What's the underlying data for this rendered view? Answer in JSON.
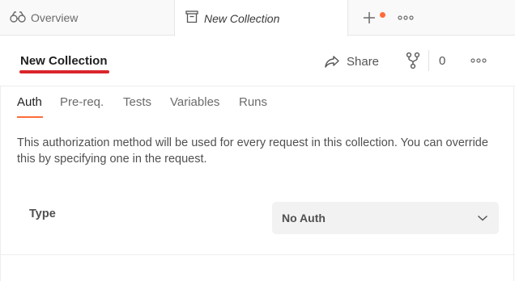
{
  "tabs": {
    "overview_label": "Overview",
    "active_label": "New Collection"
  },
  "header": {
    "title": "New Collection",
    "share_label": "Share",
    "fork_count": "0"
  },
  "subtabs": [
    "Auth",
    "Pre-req.",
    "Tests",
    "Variables",
    "Runs"
  ],
  "auth": {
    "description": "This authorization method will be used for every request in this collection. You can override this by specifying one in the request.",
    "type_label": "Type",
    "type_value": "No Auth"
  },
  "colors": {
    "accent": "#ff6c37",
    "underline": "#d9262b"
  }
}
